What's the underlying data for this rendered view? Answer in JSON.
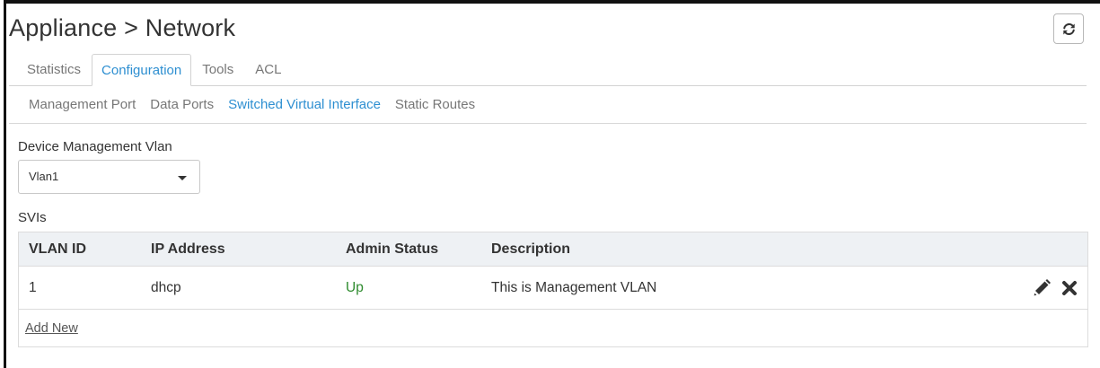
{
  "header": {
    "title": "Appliance > Network",
    "refresh_icon": "refresh-icon"
  },
  "tabs": [
    {
      "label": "Statistics",
      "active": false
    },
    {
      "label": "Configuration",
      "active": true
    },
    {
      "label": "Tools",
      "active": false
    },
    {
      "label": "ACL",
      "active": false
    }
  ],
  "subtabs": [
    {
      "label": "Management Port",
      "active": false
    },
    {
      "label": "Data Ports",
      "active": false
    },
    {
      "label": "Switched Virtual Interface",
      "active": true
    },
    {
      "label": "Static Routes",
      "active": false
    }
  ],
  "device_mgmt": {
    "label": "Device Management Vlan",
    "selected": "Vlan1"
  },
  "svis": {
    "label": "SVIs",
    "columns": [
      "VLAN ID",
      "IP Address",
      "Admin Status",
      "Description"
    ],
    "rows": [
      {
        "vlan_id": "1",
        "ip_address": "dhcp",
        "admin_status": "Up",
        "description": "This is Management VLAN"
      }
    ],
    "add_new_label": "Add New"
  },
  "colors": {
    "accent": "#2e8fd1",
    "status_up": "#2e8b2e",
    "table_header_bg": "#eef1f4"
  },
  "icons": {
    "edit": "pencil-icon",
    "delete": "close-icon",
    "dropdown": "chevron-down-icon"
  }
}
